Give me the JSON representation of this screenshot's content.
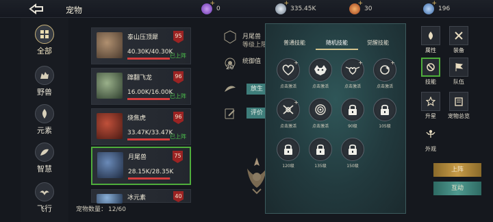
{
  "header": {
    "title": "宠物",
    "currencies": [
      {
        "icon": "purple-gem-icon",
        "value": "0",
        "color": "#8e5ad6"
      },
      {
        "icon": "silver-coin-icon",
        "value": "335.45K",
        "color": "#8aa0b8"
      },
      {
        "icon": "orange-orb-icon",
        "value": "30",
        "color": "#d46a2a"
      },
      {
        "icon": "blue-crystal-icon",
        "value": "196",
        "color": "#6a9bd6"
      }
    ]
  },
  "left_nav": {
    "items": [
      {
        "label": "全部",
        "icon": "grid-icon",
        "active": true
      },
      {
        "label": "野兽",
        "icon": "beast-icon"
      },
      {
        "label": "元素",
        "icon": "element-icon"
      },
      {
        "label": "智慧",
        "icon": "wisdom-icon"
      },
      {
        "label": "飞行",
        "icon": "flying-icon"
      }
    ]
  },
  "pets": [
    {
      "name": "泰山压顶犀",
      "hp": "40.30K/40.30K",
      "hp_fraction": 1.0,
      "level": "95",
      "status": "已上阵",
      "color": "#6b5a4a"
    },
    {
      "name": "蹿翻飞龙",
      "hp": "16.00K/16.00K",
      "hp_fraction": 1.0,
      "level": "96",
      "status": "已上阵",
      "color": "#556b4a"
    },
    {
      "name": "烧焦虎",
      "hp": "33.47K/33.47K",
      "hp_fraction": 1.0,
      "level": "96",
      "status": "已上阵",
      "color": "#8a3a2a"
    },
    {
      "name": "月尾兽",
      "hp": "28.15K/28.35K",
      "hp_fraction": 0.99,
      "level": "75",
      "status": "",
      "color": "#3a4a6a",
      "selected": true
    },
    {
      "name": "冰元素",
      "hp": "",
      "level": "40",
      "status": "",
      "color": "#4a6a8a"
    }
  ],
  "pet_count": {
    "label": "宠物数量：",
    "value": "12/60"
  },
  "detail": {
    "name": "月尾兽",
    "level_text": "等级上限",
    "command_label": "统御值",
    "command_value": "20",
    "release_label": "放生",
    "review_label": "评价"
  },
  "skills_panel": {
    "tabs": [
      "普通技能",
      "随机技能",
      "觉醒技能"
    ],
    "active_tab": 1,
    "slots": [
      {
        "icon": "heart-swirl-icon",
        "caption": "点击激活",
        "plus": true
      },
      {
        "icon": "wolf-head-icon",
        "caption": "点击激活"
      },
      {
        "icon": "winged-heart-icon",
        "caption": "点击激活",
        "plus": true
      },
      {
        "icon": "sparkle-ring-icon",
        "caption": "点击激活",
        "plus": true
      },
      {
        "icon": "crossed-swords-icon",
        "caption": "点击激活",
        "plus": true
      },
      {
        "icon": "vortex-icon",
        "caption": "点击激活"
      },
      {
        "icon": "lock-icon",
        "caption": "90级"
      },
      {
        "icon": "lock-icon",
        "caption": "105级"
      },
      {
        "icon": "lock-icon",
        "caption": "120级"
      },
      {
        "icon": "lock-icon",
        "caption": "135级"
      },
      {
        "icon": "lock-icon",
        "caption": "150级"
      }
    ]
  },
  "right_menu": [
    {
      "label": "属性",
      "icon": "flame-icon"
    },
    {
      "label": "装备",
      "icon": "crossed-swords-icon"
    },
    {
      "label": "技能",
      "icon": "shield-slash-icon",
      "active": true
    },
    {
      "label": "队伍",
      "icon": "flag-icon"
    },
    {
      "label": "升星",
      "icon": "star-icon"
    },
    {
      "label": "宠物总览",
      "icon": "book-icon"
    },
    {
      "label": "外观",
      "icon": "fairy-icon"
    }
  ],
  "actions": {
    "deploy": "上阵",
    "interact": "互动"
  }
}
